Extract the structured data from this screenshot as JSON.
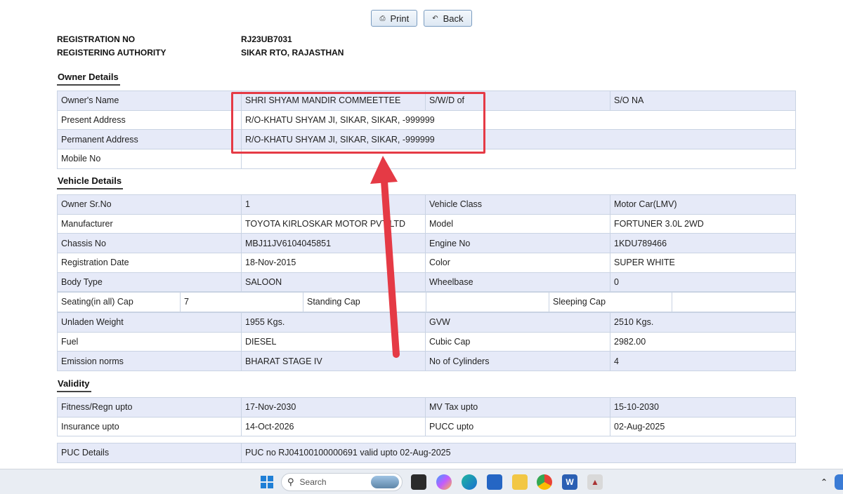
{
  "toolbar": {
    "print_label": "Print",
    "back_label": "Back"
  },
  "registration": {
    "reg_no_label": "REGISTRATION NO",
    "reg_no_value": "RJ23UB7031",
    "authority_label": "REGISTERING AUTHORITY",
    "authority_value": "SIKAR RTO, RAJASTHAN"
  },
  "owner": {
    "title": "Owner Details",
    "name_label": "Owner's Name",
    "name_value": "SHRI SHYAM MANDIR COMMEETTEE",
    "swd_label": "S/W/D of",
    "swd_value": "S/O NA",
    "present_label": "Present Address",
    "present_value": "R/O-KHATU SHYAM JI, SIKAR, SIKAR, -999999",
    "permanent_label": "Permanent Address",
    "permanent_value": "R/O-KHATU SHYAM JI, SIKAR, SIKAR, -999999",
    "mobile_label": "Mobile No",
    "mobile_value": ""
  },
  "vehicle": {
    "title": "Vehicle Details",
    "rows": [
      [
        "Owner Sr.No",
        "1",
        "Vehicle Class",
        "Motor Car(LMV)"
      ],
      [
        "Manufacturer",
        "TOYOTA KIRLOSKAR MOTOR PVT LTD",
        "Model",
        "FORTUNER 3.0L 2WD"
      ],
      [
        "Chassis No",
        "MBJ11JV6104045851",
        "Engine No",
        "1KDU789466"
      ],
      [
        "Registration Date",
        "18-Nov-2015",
        "Color",
        "SUPER WHITE"
      ],
      [
        "Body Type",
        "SALOON",
        "Wheelbase",
        "0"
      ]
    ],
    "seating": {
      "seating_label": "Seating(in all) Cap",
      "seating_value": "7",
      "standing_label": "Standing Cap",
      "standing_value": "",
      "sleeping_label": "Sleeping Cap",
      "sleeping_value": ""
    },
    "rows2": [
      [
        "Unladen Weight",
        "1955 Kgs.",
        "GVW",
        "2510 Kgs."
      ],
      [
        "Fuel",
        "DIESEL",
        "Cubic Cap",
        "2982.00"
      ],
      [
        "Emission norms",
        "BHARAT STAGE IV",
        "No of Cylinders",
        "4"
      ]
    ]
  },
  "validity": {
    "title": "Validity",
    "rows": [
      [
        "Fitness/Regn upto",
        "17-Nov-2030",
        "MV Tax upto",
        "15-10-2030"
      ],
      [
        "Insurance upto",
        "14-Oct-2026",
        "PUCC upto",
        "02-Aug-2025"
      ]
    ],
    "puc_label": "PUC Details",
    "puc_value": "PUC no RJ04100100000691 valid upto 02-Aug-2025"
  },
  "taskbar": {
    "search_placeholder": "Search"
  },
  "colors": {
    "highlight": "#e53a45",
    "row_alt": "#e6eaf8",
    "taskbar": "#e9edf3"
  }
}
